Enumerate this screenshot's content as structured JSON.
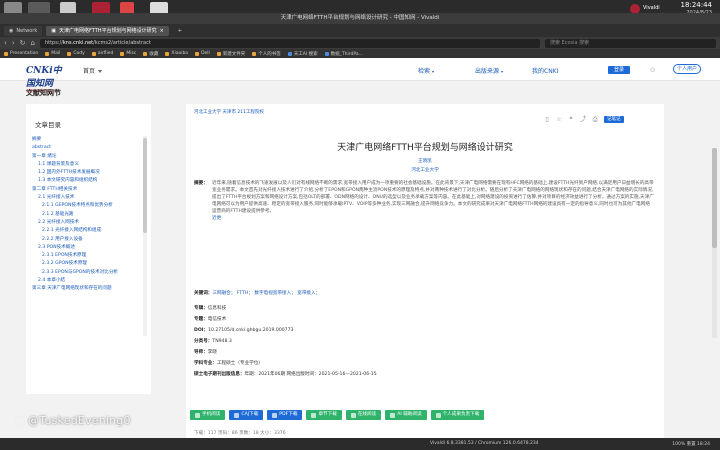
{
  "os": {
    "clock_time": "18:24:44",
    "clock_date": "2024/8/23",
    "user": "Vivaldi"
  },
  "browser": {
    "window_title": "天津广电网络FTTH平台规划与网络设计研究 - 中国知网 - Vivaldi",
    "tabs": [
      "Network",
      "天津广电网络FTTH平台规划与网络设计研究"
    ],
    "url_host": "kns.cnki.net",
    "url_path": "/kcms2/article/abstract",
    "url_prefix": "https://",
    "search_placeholder": "搜索 Ecosia 搜索",
    "bookmarks": [
      "Presentation",
      "Mail",
      "Cody",
      "airflied",
      "Misc",
      "收藏",
      "Xiaoiba",
      "Dell",
      "新建文件夹",
      "个人的书签",
      "天工AI 搜索",
      "数据_ThirdPa..."
    ]
  },
  "cnki": {
    "logo_text": "CNKi中国知网",
    "logo_sub": "中国知识基础设施工程",
    "home_label": "首页",
    "nav": [
      "检索",
      "出版来源",
      "我的CNKI"
    ],
    "login_label": "登录",
    "personal_label": "个人用户",
    "section_title": "文献知网节"
  },
  "toc": {
    "heading": "文章目录",
    "items": [
      {
        "label": "摘要",
        "level": 1
      },
      {
        "label": "abstract",
        "level": 1
      },
      {
        "label": "第一章 绪论",
        "level": 1
      },
      {
        "label": "1.1 课题背景及意义",
        "level": 2
      },
      {
        "label": "1.2 国内外FTTH技术发展概况",
        "level": 2
      },
      {
        "label": "1.3 本文研究内容和组织结构",
        "level": 2
      },
      {
        "label": "第二章 FTTH相关技术",
        "level": 1
      },
      {
        "label": "2.1 光纤接入技术",
        "level": 2
      },
      {
        "label": "2.1.1 GEPON技术特点和优势分析",
        "level": 3
      },
      {
        "label": "2.1.2 基础光路",
        "level": 3
      },
      {
        "label": "2.2 光纤接入网技术",
        "level": 2
      },
      {
        "label": "2.2.1 光纤接入网结构和组成",
        "level": 3
      },
      {
        "label": "2.2.2 用户接入设备",
        "level": 3
      },
      {
        "label": "2.3 PON技术概述",
        "level": 2
      },
      {
        "label": "2.3.1 EPON技术原理",
        "level": 3
      },
      {
        "label": "2.3.2 GPON技术原理",
        "level": 3
      },
      {
        "label": "2.3.3 EPON与GPON的技术对比分析",
        "level": 3
      },
      {
        "label": "2.4 本章小结",
        "level": 2
      },
      {
        "label": "第三章 天津广电网络现状和存在的问题",
        "level": 1
      }
    ]
  },
  "article": {
    "breadcrumb": "河北工业大学  天津市 211工程院校",
    "favorite_label": "记笔记",
    "title": "天津广电网络FTTH平台规划与网络设计研究",
    "author": "王晓凯",
    "affiliation": "河北工业大学",
    "abstract_label": "摘要：",
    "abstract_text": "近年来,随着信息技术的飞速发展以及人们对有线网络不断的需求,宽带接入用户成为一项重要的社会基础设施。在此背景下,天津广电网络需要在现有HFC网络的基础上,建设FTTH光纤到户网络,以满足用户日益增长的高带宽业务需求。本文首先对光纤接入技术进行了介绍,分析了EPON和GPON两种主流PON技术的原理及特点,并对两种技术进行了对比分析。随后分析了天津广电网络的网络现状和存在的问题,结合天津广电网络的实际情况,提出了FTTH平台规划方案和网络设计方案,包括OLT的部署、ODN网络的设计、ONU的选型以及业务承载方案等内容。在此基础上,对网络建设的投资进行了估算,并对项目的经济效益进行了分析。通过方案的实施,天津广电网络可以为用户提供高速、稳定的宽带接入服务,同时能够承载IPTV、VOIP等多种业务,实现三网融合,提升网络竞争力。本文的研究成果对天津广电网络FTTH网络的建设具有一定的指导意义,同时也可为其他广电网络运营商的FTTH建设提供参考。",
    "abstract_end": "近更",
    "fields": [
      {
        "label": "关键词：",
        "value": "三网融合；  FTTH；  数字电视宽带接入；  宽带接入；"
      },
      {
        "label": "专辑：",
        "value": "信息科技"
      },
      {
        "label": "专题：",
        "value": "电信技术"
      },
      {
        "label": "DOI：",
        "value": "10.27105/d.cnki.ghbgu.2019.000773"
      },
      {
        "label": "分类号：",
        "value": "TN948.3"
      },
      {
        "label": "导师：",
        "value": "李晓"
      },
      {
        "label": "学科专业：",
        "value": "工程硕士（专业学位）"
      },
      {
        "label": "硕士电子期刊出版信息：",
        "value": "年期：2021年06期      网络出版时间：2021-05-16—2021-06-15"
      }
    ],
    "actions": [
      "手机阅读",
      "CAJ下载",
      "PDF下载",
      "章节下载",
      "在线阅读",
      "AI 辅助阅读",
      "个人成果负责下载"
    ],
    "stats": "下载：117    页码：86    页数：18    大小：3376"
  },
  "statusbar": {
    "info": "Vivaldi 6.8.3381.53 / Chromium 126.0.6478.234",
    "right": "100%   重置   18:24"
  },
  "watermark": "@TuskedEvening0"
}
